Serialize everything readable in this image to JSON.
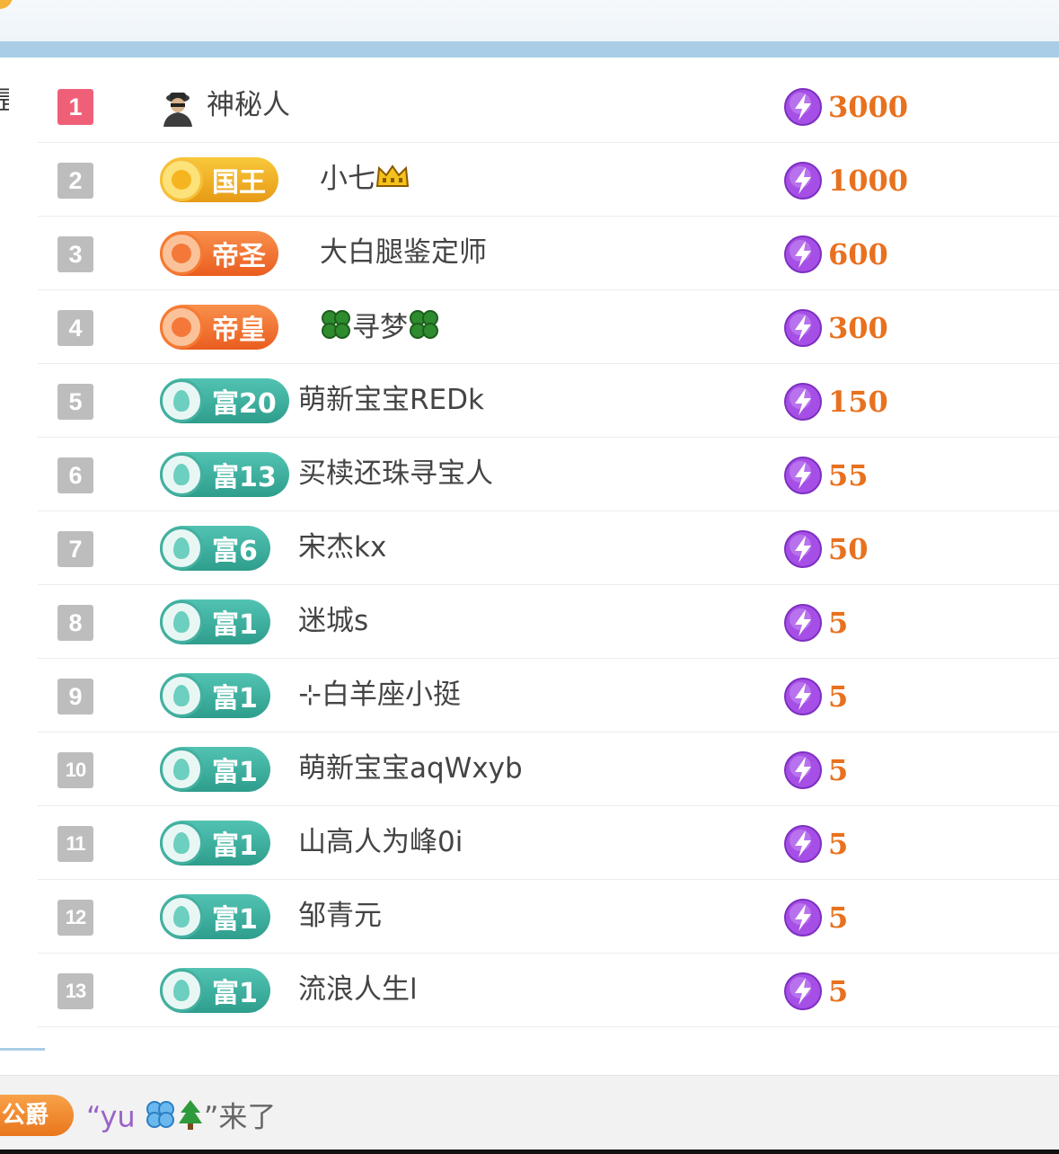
{
  "colors": {
    "accent_blue": "#a9cde6",
    "rank_first": "#ef6078",
    "rank_default": "#bdbdbd",
    "amount": "#e8711f",
    "wealth_teal": "#3fae9e",
    "king_gold": "#f2b32a",
    "emperor_orange": "#f0702f"
  },
  "side_glyph": "昰",
  "leaderboard": [
    {
      "rank": "1",
      "badge": null,
      "avatar_icon": "mystery-person-icon",
      "name": "神秘人",
      "name_suffix_icon": null,
      "amount": "3000"
    },
    {
      "rank": "2",
      "badge": {
        "label": "国王",
        "style": "gold"
      },
      "name": "小七",
      "name_suffix_icon": "crown-icon",
      "amount": "1000"
    },
    {
      "rank": "3",
      "badge": {
        "label": "帝圣",
        "style": "orange"
      },
      "name": "大白腿鉴定师",
      "amount": "600"
    },
    {
      "rank": "4",
      "badge": {
        "label": "帝皇",
        "style": "orange"
      },
      "name": "寻梦",
      "name_prefix_icon": "four-leaf-clover-icon",
      "name_suffix_icon": "four-leaf-clover-icon",
      "amount": "300"
    },
    {
      "rank": "5",
      "badge": {
        "label": "富20",
        "style": "teal"
      },
      "name": "萌新宝宝REDk",
      "amount": "150"
    },
    {
      "rank": "6",
      "badge": {
        "label": "富13",
        "style": "teal"
      },
      "name": "买椟还珠寻宝人",
      "amount": "55"
    },
    {
      "rank": "7",
      "badge": {
        "label": "富6",
        "style": "teal"
      },
      "name": "宋杰kx",
      "amount": "50"
    },
    {
      "rank": "8",
      "badge": {
        "label": "富1",
        "style": "teal"
      },
      "name": "迷城s",
      "amount": "5"
    },
    {
      "rank": "9",
      "badge": {
        "label": "富1",
        "style": "teal"
      },
      "name": "⊹白羊座小挺",
      "amount": "5"
    },
    {
      "rank": "10",
      "badge": {
        "label": "富1",
        "style": "teal"
      },
      "name": "萌新宝宝aqWxyb",
      "amount": "5"
    },
    {
      "rank": "11",
      "badge": {
        "label": "富1",
        "style": "teal"
      },
      "name": "山高人为峰0i",
      "amount": "5"
    },
    {
      "rank": "12",
      "badge": {
        "label": "富1",
        "style": "teal"
      },
      "name": "邹青元",
      "amount": "5"
    },
    {
      "rank": "13",
      "badge": {
        "label": "富1",
        "style": "teal"
      },
      "name": "流浪人生l",
      "amount": "5"
    }
  ],
  "chat_message": {
    "badge": "公爵",
    "text_open": "“yu",
    "text_close": "”来了",
    "icons": [
      "blue-clover-icon",
      "tree-icon"
    ]
  }
}
